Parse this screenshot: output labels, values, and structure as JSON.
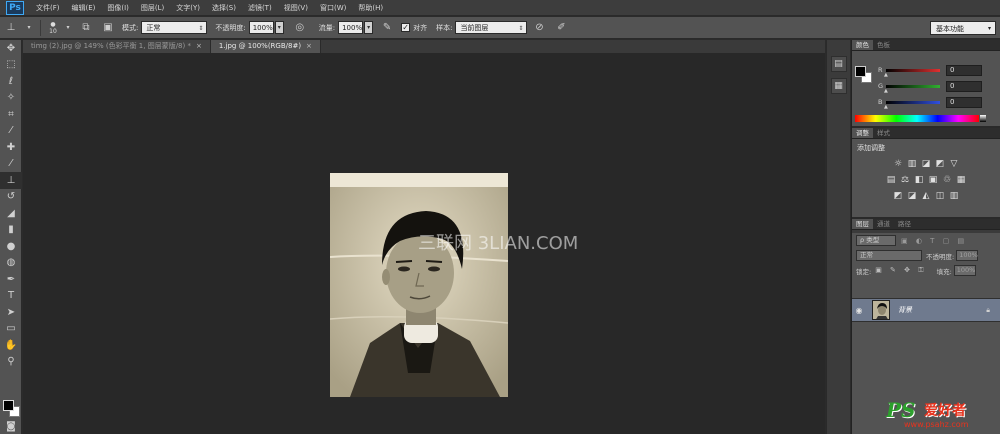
{
  "app": {
    "logo": "Ps"
  },
  "menu": [
    "文件(F)",
    "编辑(E)",
    "图像(I)",
    "图层(L)",
    "文字(Y)",
    "选择(S)",
    "滤镜(T)",
    "视图(V)",
    "窗口(W)",
    "帮助(H)"
  ],
  "options": {
    "brush_size": "10",
    "mode_label": "模式:",
    "mode_value": "正常",
    "opacity_label": "不透明度:",
    "opacity_value": "100%",
    "flow_label": "流量:",
    "flow_value": "100%",
    "align_label": "对齐",
    "sample_label": "样本:",
    "sample_value": "当前图层",
    "workspace": "基本功能"
  },
  "tabs": [
    {
      "label": "timg (2).jpg @ 149% (色彩平衡 1, 图层蒙版/8) *",
      "close": "×"
    },
    {
      "label": "1.jpg @ 100%(RGB/8#)",
      "close": "×"
    }
  ],
  "canvas": {
    "watermark": "三联网 3LIAN.COM"
  },
  "panels": {
    "color_tabs": [
      "颜色",
      "色板"
    ],
    "rgb": [
      {
        "label": "R",
        "value": "0",
        "color": "#e03030"
      },
      {
        "label": "G",
        "value": "0",
        "color": "#30b030"
      },
      {
        "label": "B",
        "value": "0",
        "color": "#3050e0"
      }
    ],
    "adjust_tabs": [
      "调整",
      "样式"
    ],
    "adjust_title": "添加调整",
    "layers_tabs": [
      "图层",
      "通道",
      "路径"
    ],
    "layer_filter": "ρ 类型",
    "blend_mode": "正常",
    "opacity_label": "不透明度:",
    "opacity_value": "100%",
    "lock_label": "锁定:",
    "fill_label": "填充:",
    "fill_value": "100%",
    "layer_name": "背景"
  },
  "site_logo": {
    "ps": "PS",
    "cn": "爱好者",
    "url": "www.psahz.com"
  },
  "colors": {
    "accent": "#3fa9f5",
    "layer_selected": "#6f7a8e"
  }
}
